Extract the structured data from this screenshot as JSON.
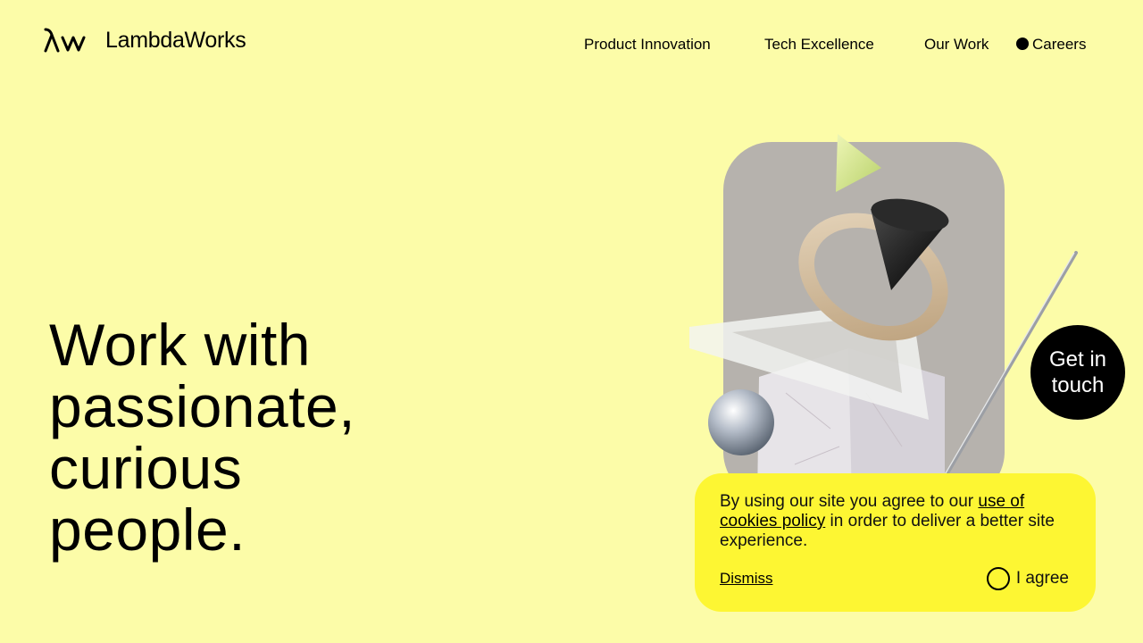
{
  "brand": {
    "name": "LambdaWorks",
    "logo_icon": "lambda-w-logo-icon"
  },
  "nav": {
    "items": [
      {
        "label": "Product Innovation"
      },
      {
        "label": "Tech Excellence"
      },
      {
        "label": "Our Work"
      },
      {
        "label": "Careers",
        "active": true
      }
    ]
  },
  "hero": {
    "headline": [
      "Work with",
      "passionate,",
      "curious",
      "people."
    ],
    "image_icon": "abstract-3d-shapes-illustration"
  },
  "cta": {
    "label": "Get in touch"
  },
  "cookie_banner": {
    "text_before": "By using our site you agree to our ",
    "link": "use of cookies policy",
    "text_after": " in order to deliver a better site experience.",
    "dismiss": "Dismiss",
    "agree": "I agree"
  },
  "colors": {
    "background": "#fcfca8",
    "banner": "#fdf633",
    "accent": "#000000",
    "image_panel": "#b6b2ad"
  }
}
